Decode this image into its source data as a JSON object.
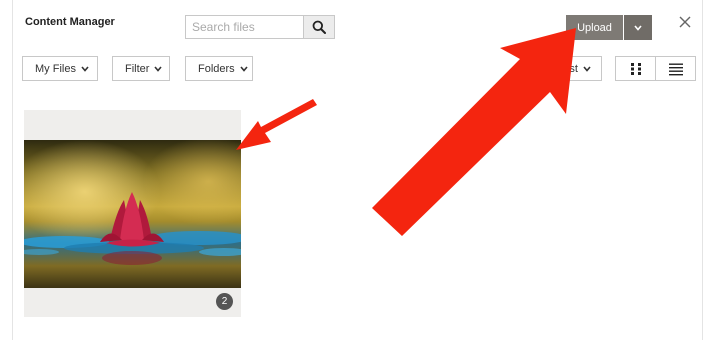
{
  "header": {
    "title": "Content Manager",
    "search_placeholder": "Search files",
    "upload_label": "Upload"
  },
  "toolbar": {
    "filters": [
      {
        "label": "My Files"
      },
      {
        "label": "Filter"
      },
      {
        "label": "Folders"
      }
    ],
    "sort_label": "rst",
    "views": [
      "grid",
      "list"
    ]
  },
  "files": [
    {
      "image": "pink water lily on blue water",
      "badge": "2"
    }
  ],
  "colors": {
    "upload_bg": "#7e7a75",
    "annotation_arrow": "#f4250f",
    "card_bg": "#efeeec"
  }
}
